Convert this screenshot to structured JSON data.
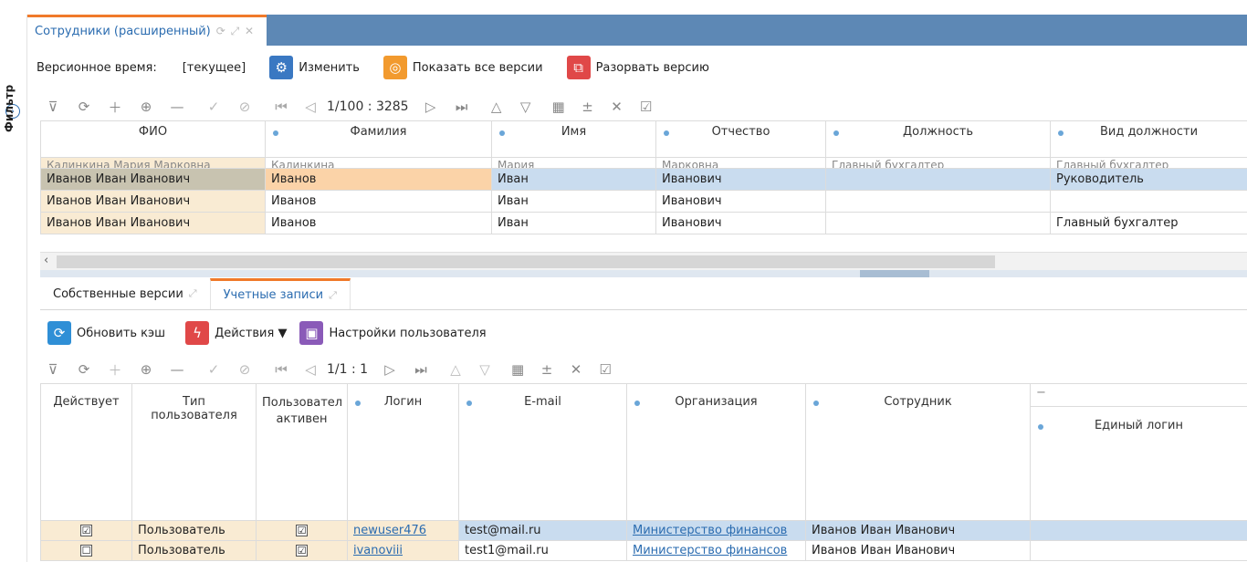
{
  "tab": {
    "title": "Сотрудники (расширенный)"
  },
  "version_bar": {
    "label": "Версионное время:",
    "value": "[текущее]",
    "edit": "Изменить",
    "show_all": "Показать все версии",
    "break": "Разорвать версию"
  },
  "filter_label": "Фильтр",
  "top_pager": "1/100 : 3285",
  "top_grid": {
    "headers": [
      "ФИО",
      "Фамилия",
      "Имя",
      "Отчество",
      "Должность",
      "Вид должности"
    ],
    "partial_row": [
      "Калинкина Мария Марковна",
      "Калинкина",
      "Мария",
      "Марковна",
      "Главный бухгалтер",
      "Главный бухгалтер"
    ],
    "rows": [
      [
        "Иванов Иван Иванович",
        "Иванов",
        "Иван",
        "Иванович",
        "",
        "Руководитель"
      ],
      [
        "Иванов Иван Иванович",
        "Иванов",
        "Иван",
        "Иванович",
        "",
        ""
      ],
      [
        "Иванов Иван Иванович",
        "Иванов",
        "Иван",
        "Иванович",
        "",
        "Главный бухгалтер"
      ]
    ]
  },
  "subtabs": [
    "Собственные версии",
    "Учетные записи"
  ],
  "actions": {
    "refresh_cache": "Обновить кэш",
    "actions": "Действия ▼",
    "user_settings": "Настройки пользователя"
  },
  "bottom_pager": "1/1 : 1",
  "bottom_grid": {
    "headers": [
      "Действует",
      "Тип пользователя",
      "Пользовател активен",
      "Логин",
      "E-mail",
      "Организация",
      "Сотрудник",
      "Единый логин"
    ],
    "rows": [
      {
        "active": "☑",
        "type": "Пользователь",
        "user_active": "☑",
        "login": "newuser476",
        "email": "test@mail.ru",
        "org": "Министерство финансов",
        "employee": "Иванов Иван Иванович"
      },
      {
        "active": "☐",
        "type": "Пользователь",
        "user_active": "☑",
        "login": "ivanoviii",
        "email": "test1@mail.ru",
        "org": "Министерство финансов",
        "employee": "Иванов Иван Иванович"
      }
    ]
  },
  "colors": {
    "accent": "#f07a2a",
    "tabstrip": "#5d88b5",
    "link": "#2b6cb0",
    "selected_row": "#c9dcef"
  }
}
